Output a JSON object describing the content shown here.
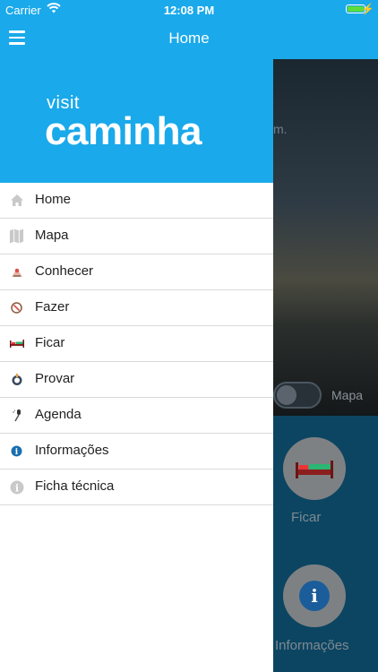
{
  "status": {
    "carrier": "Carrier",
    "time": "12:08 PM"
  },
  "nav": {
    "title": "Home"
  },
  "logo": {
    "visit": "visit",
    "name": "caminha"
  },
  "menu": [
    {
      "label": "Home",
      "icon": "home-icon"
    },
    {
      "label": "Mapa",
      "icon": "map-icon"
    },
    {
      "label": "Conhecer",
      "icon": "landmark-icon"
    },
    {
      "label": "Fazer",
      "icon": "compass-icon"
    },
    {
      "label": "Ficar",
      "icon": "bed-icon"
    },
    {
      "label": "Provar",
      "icon": "dining-icon"
    },
    {
      "label": "Agenda",
      "icon": "microphone-icon"
    },
    {
      "label": "Informações",
      "icon": "info-icon"
    },
    {
      "label": "Ficha técnica",
      "icon": "info-gray-icon"
    }
  ],
  "background": {
    "hero_text": "m.",
    "toggle_label": "Mapa",
    "tile1_label": "Ficar",
    "tile2_label": "Informações"
  },
  "colors": {
    "brand": "#1aa9ea",
    "divider": "#d9d9d9"
  }
}
